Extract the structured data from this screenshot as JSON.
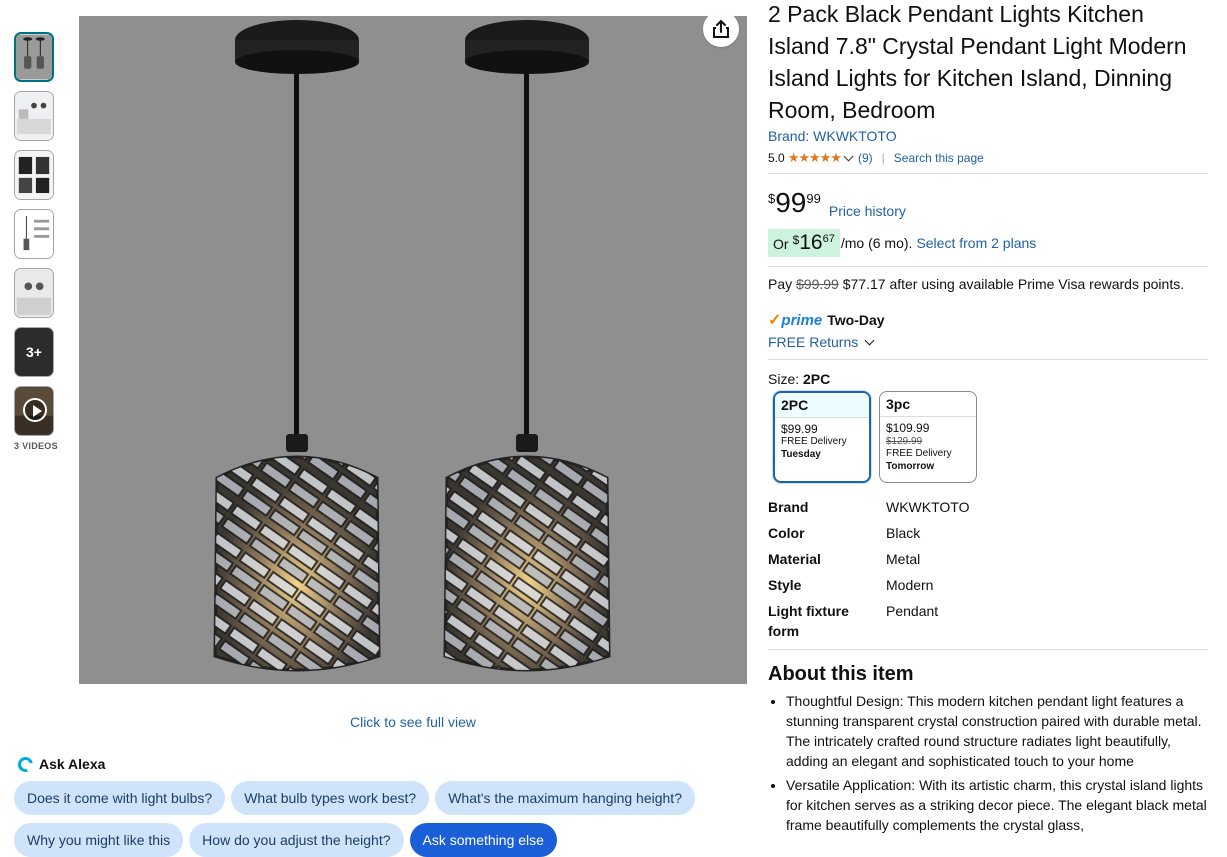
{
  "thumbnails": {
    "more_label": "3+",
    "videos_label": "3 VIDEOS"
  },
  "image": {
    "full_view": "Click to see full view"
  },
  "alexa": {
    "title": "Ask Alexa",
    "chips_row1": [
      "Does it come with light bulbs?",
      "What bulb types work best?",
      "What's the maximum hanging height?"
    ],
    "chips_row2": [
      "Why you might like this",
      "How do you adjust the height?"
    ],
    "primary_chip": "Ask something else"
  },
  "product": {
    "title": "2 Pack Black Pendant Lights Kitchen Island 7.8\" Crystal Pendant Light Modern Island Lights for Kitchen Island, Dinning Room, Bedroom",
    "brand_link": "Brand: WKWKTOTO",
    "rating": "5.0",
    "stars": "★★★★★",
    "review_count": "(9)",
    "search_page": "Search this page"
  },
  "price": {
    "symbol": "$",
    "whole": "99",
    "fraction": "99",
    "history": "Price history",
    "monthly_or": "Or",
    "monthly_symbol": "$",
    "monthly_whole": "16",
    "monthly_fraction": "67",
    "monthly_suffix": "/mo (6 mo).",
    "plans_link": "Select from 2 plans",
    "pay_prefix": "Pay",
    "pay_original": "$99.99",
    "pay_suffix": "$77.17 after using available Prime Visa rewards points."
  },
  "shipping": {
    "check": "✓",
    "prime_word": "prime",
    "speed": "Two-Day",
    "returns": "FREE Returns"
  },
  "size": {
    "label": "Size:",
    "selected": "2PC",
    "options": [
      {
        "name": "2PC",
        "price": "$99.99",
        "strike": "",
        "delivery": "FREE Delivery",
        "day": "Tuesday"
      },
      {
        "name": "3pc",
        "price": "$109.99",
        "strike": "$129.99",
        "delivery": "FREE Delivery",
        "day": "Tomorrow"
      }
    ]
  },
  "specs": [
    {
      "key": "Brand",
      "value": "WKWKTOTO"
    },
    {
      "key": "Color",
      "value": "Black"
    },
    {
      "key": "Material",
      "value": "Metal"
    },
    {
      "key": "Style",
      "value": "Modern"
    },
    {
      "key": "Light fixture form",
      "value": "Pendant"
    }
  ],
  "about": {
    "heading": "About this item",
    "bullets": [
      "Thoughtful Design: This modern kitchen pendant light features a stunning transparent crystal construction paired with durable metal. The intricately crafted round structure radiates light beautifully, adding an elegant and sophisticated touch to your home",
      "Versatile Application: With its artistic charm, this crystal island lights for kitchen serves as a striking decor piece. The elegant black metal frame beautifully complements the crystal glass,"
    ]
  },
  "colors": {
    "link": "#2162a1",
    "star": "#de7921",
    "prime_blue": "#1b7fd4",
    "deal_green_bg": "#cdf3dd",
    "primary_chip": "#1a5ed8"
  }
}
